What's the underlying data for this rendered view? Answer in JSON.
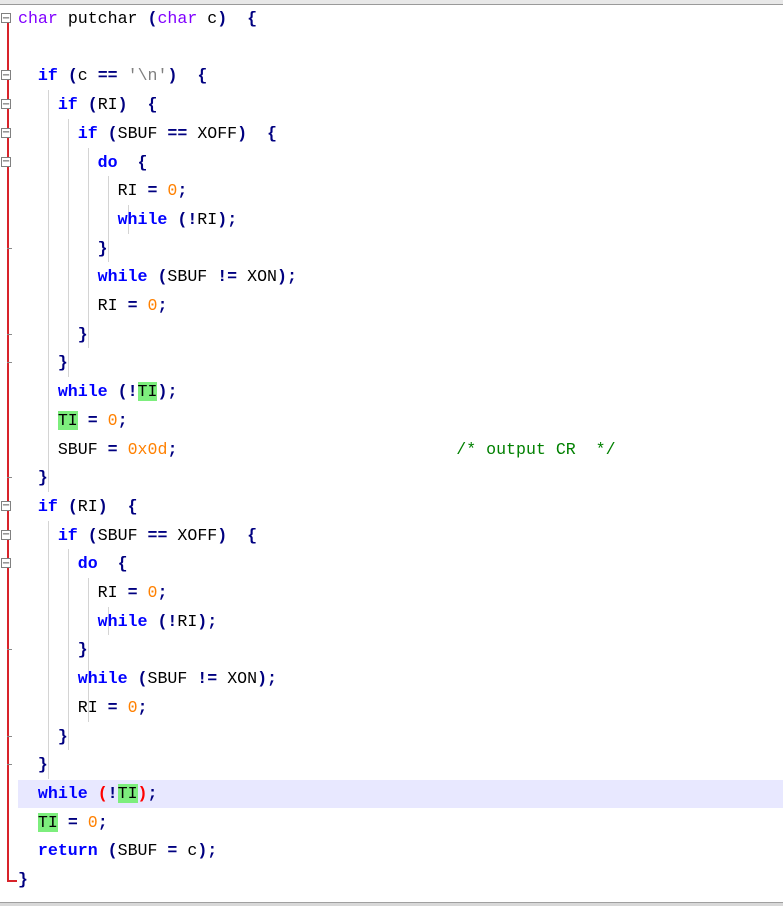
{
  "editor": {
    "colors": {
      "keyword": "#0000ff",
      "type": "#8000ff",
      "number": "#ff8000",
      "string": "#808080",
      "comment": "#008000",
      "operator": "#000080",
      "highlight": "#7dee7d",
      "brace_match": "#ff0000",
      "fold_margin": "#d8232a",
      "current_line": "#e8e8ff"
    },
    "icons": [
      "fold-collapse-icon"
    ],
    "highlighted_identifier": "TI",
    "current_line_index": 27,
    "lines": [
      [
        "char",
        " ",
        "putchar",
        " ",
        "(",
        "char",
        " ",
        "c",
        ")",
        "  ",
        "{"
      ],
      [],
      [
        "  ",
        "if",
        " ",
        "(",
        "c",
        " ",
        "==",
        " ",
        "'\\n'",
        ")",
        "  ",
        "{"
      ],
      [
        "    ",
        "if",
        " ",
        "(",
        "RI",
        ")",
        "  ",
        "{"
      ],
      [
        "      ",
        "if",
        " ",
        "(",
        "SBUF",
        " ",
        "==",
        " ",
        "XOFF",
        ")",
        "  ",
        "{"
      ],
      [
        "        ",
        "do",
        "  ",
        "{"
      ],
      [
        "          ",
        "RI",
        " ",
        "=",
        " ",
        "0",
        ";"
      ],
      [
        "          ",
        "while",
        " ",
        "(",
        "!",
        "RI",
        ")",
        ";"
      ],
      [
        "        ",
        "}"
      ],
      [
        "        ",
        "while",
        " ",
        "(",
        "SBUF",
        " ",
        "!=",
        " ",
        "XON",
        ")",
        ";"
      ],
      [
        "        ",
        "RI",
        " ",
        "=",
        " ",
        "0",
        ";"
      ],
      [
        "      ",
        "}"
      ],
      [
        "    ",
        "}"
      ],
      [
        "    ",
        "while",
        " ",
        "(",
        "!",
        "TI",
        ")",
        ";"
      ],
      [
        "    ",
        "TI",
        " ",
        "=",
        " ",
        "0",
        ";"
      ],
      [
        "    ",
        "SBUF",
        " ",
        "=",
        " ",
        "0x0d",
        ";",
        "                            ",
        "/* output CR  */"
      ],
      [
        "  ",
        "}"
      ],
      [
        "  ",
        "if",
        " ",
        "(",
        "RI",
        ")",
        "  ",
        "{"
      ],
      [
        "    ",
        "if",
        " ",
        "(",
        "SBUF",
        " ",
        "==",
        " ",
        "XOFF",
        ")",
        "  ",
        "{"
      ],
      [
        "      ",
        "do",
        "  ",
        "{"
      ],
      [
        "        ",
        "RI",
        " ",
        "=",
        " ",
        "0",
        ";"
      ],
      [
        "        ",
        "while",
        " ",
        "(",
        "!",
        "RI",
        ")",
        ";"
      ],
      [
        "      ",
        "}"
      ],
      [
        "      ",
        "while",
        " ",
        "(",
        "SBUF",
        " ",
        "!=",
        " ",
        "XON",
        ")",
        ";"
      ],
      [
        "      ",
        "RI",
        " ",
        "=",
        " ",
        "0",
        ";"
      ],
      [
        "    ",
        "}"
      ],
      [
        "  ",
        "}"
      ],
      [
        "  ",
        "while",
        " ",
        "(",
        "!",
        "TI",
        ")",
        ";"
      ],
      [
        "  ",
        "TI",
        " ",
        "=",
        " ",
        "0",
        ";"
      ],
      [
        "  ",
        "return",
        " ",
        "(",
        "SBUF",
        " ",
        "=",
        " ",
        "c",
        ")",
        ";"
      ],
      [
        "}"
      ]
    ]
  }
}
